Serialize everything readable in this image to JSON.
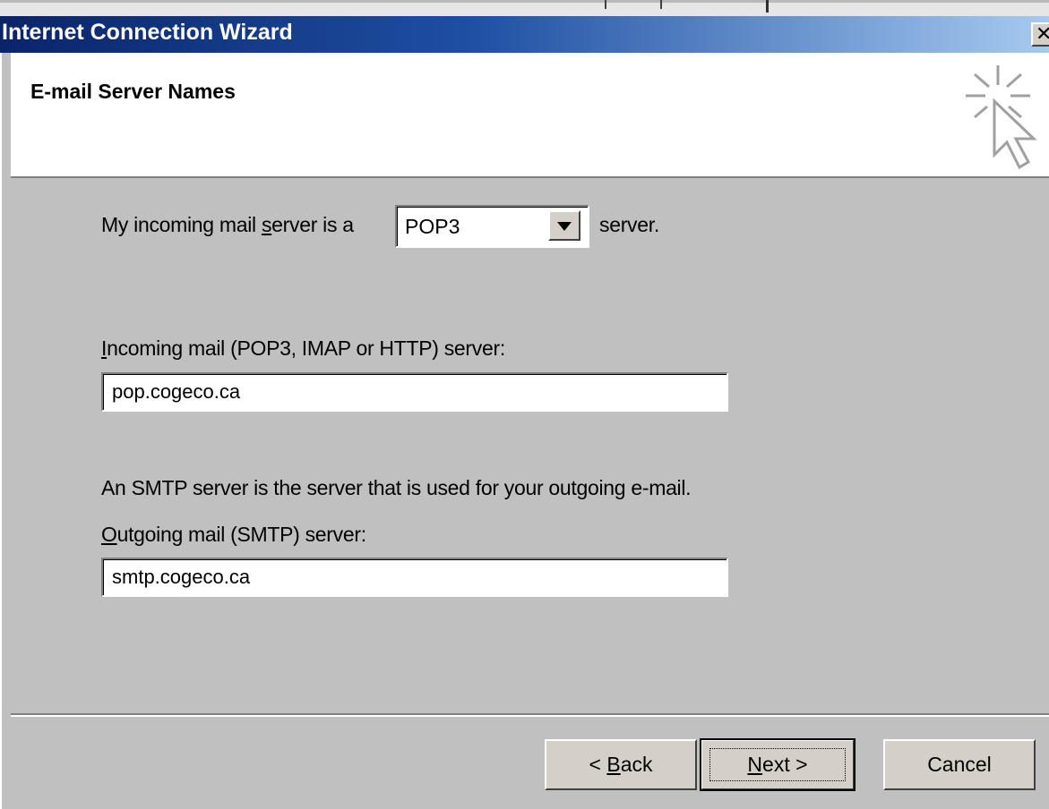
{
  "window": {
    "title": "Internet Connection Wizard",
    "close_glyph": "✕"
  },
  "header": {
    "heading": "E-mail Server Names",
    "icon": "wizard-cursor-icon"
  },
  "form": {
    "incoming_type_prefix": "My incoming mail ",
    "incoming_type_accel": "s",
    "incoming_type_rest": "erver is a",
    "incoming_type_selected": "POP3",
    "incoming_type_suffix": "server.",
    "incoming_label_accel": "I",
    "incoming_label_rest": "ncoming mail (POP3, IMAP or HTTP) server:",
    "incoming_value": "pop.cogeco.ca",
    "smtp_note": "An SMTP server is the server that is used for your outgoing e-mail.",
    "outgoing_label_accel": "O",
    "outgoing_label_rest": "utgoing mail (SMTP) server:",
    "outgoing_value": "smtp.cogeco.ca"
  },
  "buttons": {
    "back_prefix": "< ",
    "back_accel": "B",
    "back_rest": "ack",
    "next_accel": "N",
    "next_rest": "ext >",
    "cancel": "Cancel"
  },
  "colors": {
    "titlebar_start": "#0a246a",
    "titlebar_end": "#a6caf0",
    "dialog_face": "#c0c0c0"
  }
}
